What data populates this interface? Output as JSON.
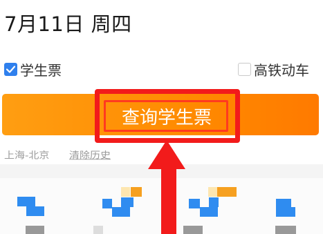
{
  "header": {
    "date": "7月11日 周四"
  },
  "options": {
    "student": {
      "label": "学生票",
      "checked": true
    },
    "high_speed": {
      "label": "高铁动车",
      "checked": false
    }
  },
  "query_button": {
    "label": "查询学生票"
  },
  "history": {
    "items": [
      "上海-北京",
      "清除历史"
    ]
  },
  "colors": {
    "button_orange": "#ff8a00",
    "highlight_red": "#f21b1b",
    "checkbox_blue": "#2f80ed"
  }
}
